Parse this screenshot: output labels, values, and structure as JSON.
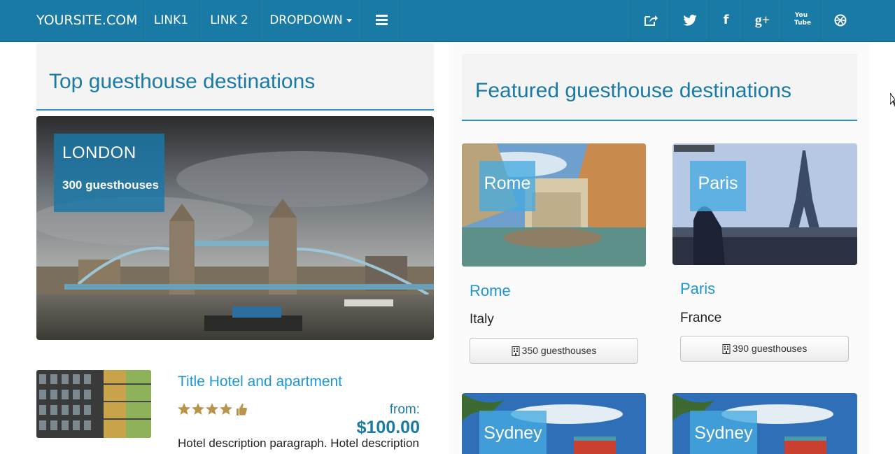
{
  "navbar": {
    "brand": "YOURSITE.COM",
    "links": [
      "LINK1",
      "LINK 2",
      "DROPDOWN"
    ],
    "social": [
      "share-icon",
      "twitter-icon",
      "facebook-icon",
      "google-plus-icon",
      "youtube-icon",
      "dribbble-icon"
    ],
    "social_labels": {
      "facebook": "f",
      "google_plus": "g+",
      "youtube": "You Tube"
    }
  },
  "top": {
    "heading": "Top guesthouse destinations",
    "hero": {
      "city": "LONDON",
      "count": "300 guesthouses"
    },
    "hotel": {
      "title": "Title Hotel and apartment",
      "rating": 4,
      "from_label": "from:",
      "price": "$100.00",
      "description": "Hotel description paragraph. Hotel description"
    }
  },
  "featured": {
    "heading": "Featured guesthouse destinations",
    "cards": [
      {
        "badge": "Rome",
        "title": "Rome",
        "country": "Italy",
        "button": "350 guesthouses"
      },
      {
        "badge": "Paris",
        "title": "Paris",
        "country": "France",
        "button": "390 guesthouses"
      },
      {
        "badge": "Sydney"
      },
      {
        "badge": "Sydney"
      }
    ]
  },
  "colors": {
    "navbar": "#1a7aa6",
    "accent": "#1e95d4",
    "heading": "#1a7aa6"
  }
}
